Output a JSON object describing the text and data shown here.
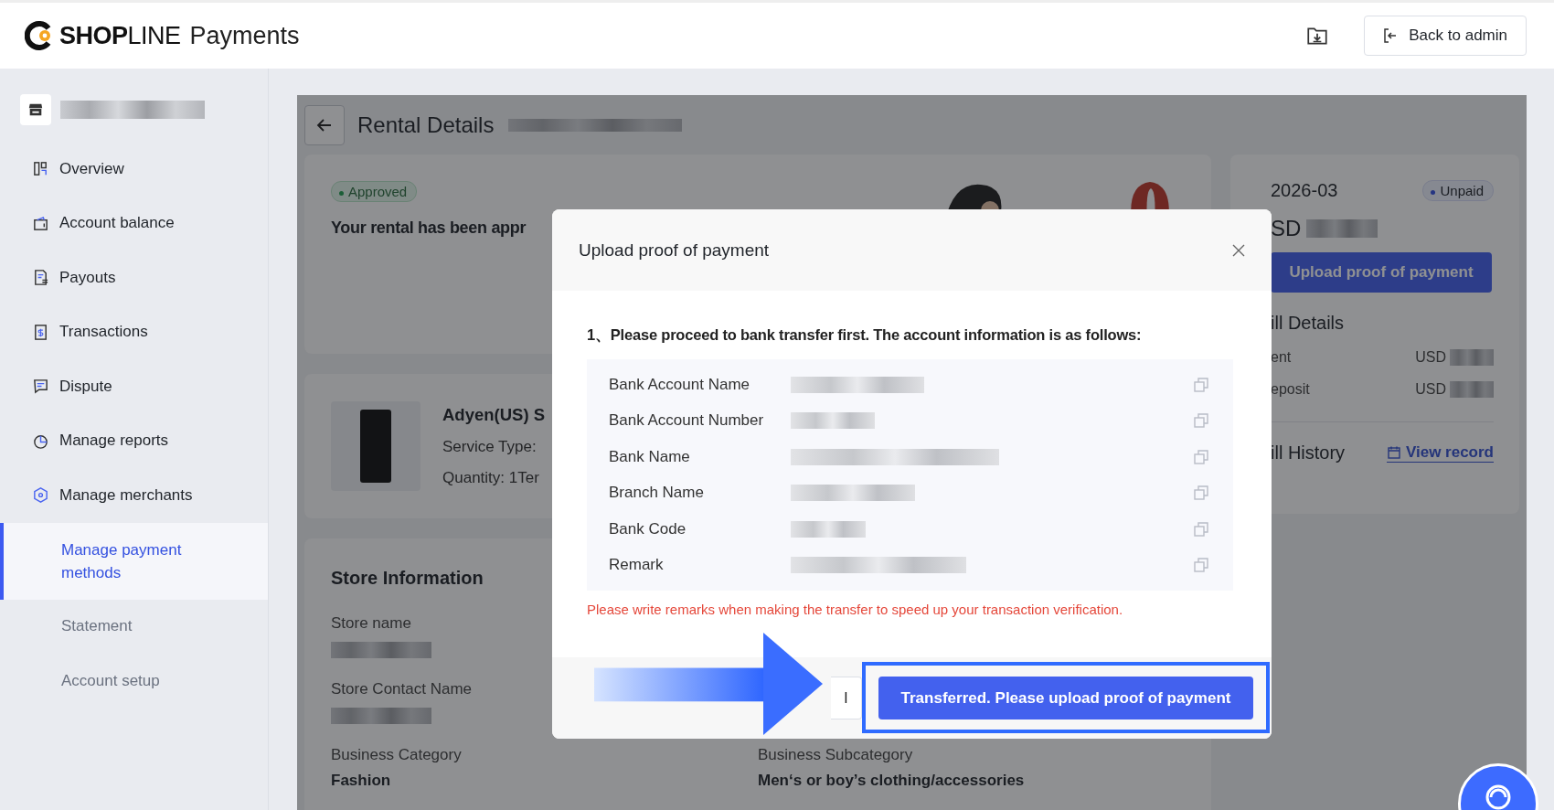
{
  "header": {
    "logo": "**SHOP**LINE",
    "product": "Payments",
    "back_button": "Back to admin"
  },
  "sidebar": {
    "items": [
      {
        "label": "Overview",
        "kind": "main",
        "selected": false
      },
      {
        "label": "Account balance",
        "kind": "main",
        "selected": false
      },
      {
        "label": "Payouts",
        "kind": "main",
        "selected": false
      },
      {
        "label": "Transactions",
        "kind": "main",
        "selected": false
      },
      {
        "label": "Dispute",
        "kind": "main",
        "selected": false
      },
      {
        "label": "Manage reports",
        "kind": "main",
        "selected": false
      },
      {
        "label": "Manage merchants",
        "kind": "main",
        "selected": false
      },
      {
        "label": "Manage payment methods",
        "kind": "sub",
        "selected": true
      },
      {
        "label": "Statement",
        "kind": "sub",
        "selected": false
      },
      {
        "label": "Account setup",
        "kind": "sub",
        "selected": false
      }
    ]
  },
  "page": {
    "title": "Rental Details",
    "rental": {
      "status": "Approved",
      "message": "Your rental has been appr"
    },
    "product": {
      "name": "Adyen(US) S",
      "service_type": "Service Type:",
      "quantity": "Quantity: 1Ter"
    },
    "store_info": {
      "title": "Store Information",
      "columns": [
        {
          "fields": [
            {
              "label": "Store name",
              "redacted": true
            },
            {
              "label": "Store Contact Name",
              "redacted": true
            },
            {
              "label": "Business Category",
              "value": "Fashion",
              "redacted": false
            }
          ]
        },
        {
          "fields": [
            {
              "label": "Business Subcategory",
              "value": "Men‘s or boy’s clothing/accessories",
              "redacted": false
            }
          ]
        }
      ]
    },
    "bill": {
      "period": "2026-03",
      "status": "Unpaid",
      "amount_prefix": "SD",
      "upload_button": "Upload proof of payment",
      "details_title": "ill Details",
      "lines": [
        {
          "label": "ent",
          "currency": "USD"
        },
        {
          "label": "eposit",
          "currency": "USD"
        }
      ],
      "history_title": "ill History",
      "view_record": "View record"
    }
  },
  "modal": {
    "title": "Upload proof of payment",
    "instruction": "1、Please proceed to bank transfer first. The account information is as follows:",
    "fields": [
      "Bank Account Name",
      "Bank Account Number",
      "Bank Name",
      "Branch Name",
      "Bank Code",
      "Remark"
    ],
    "note": "Please write remarks when making the transfer to speed up your transaction verification.",
    "cancel_button": "l",
    "confirm_button": "Transferred. Please upload proof of payment"
  }
}
